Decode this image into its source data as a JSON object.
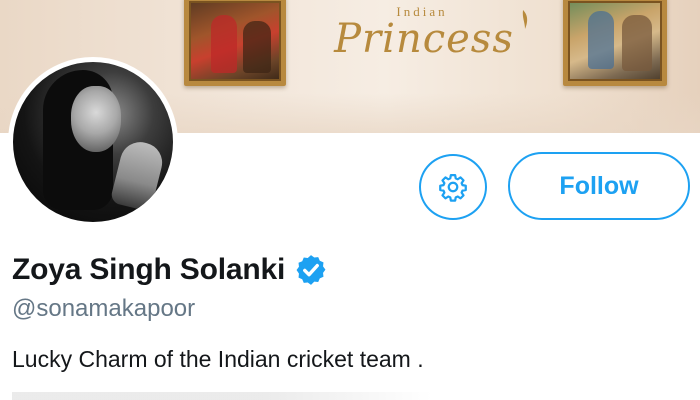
{
  "banner": {
    "logo_small": "Indian",
    "logo_big": "Princess"
  },
  "profile": {
    "display_name": "Zoya Singh Solanki",
    "handle": "@sonamakapoor",
    "bio": "Lucky Charm of the Indian cricket team .",
    "verified": true
  },
  "actions": {
    "follow_label": "Follow",
    "settings_icon": "gear-icon"
  },
  "colors": {
    "accent": "#1da1f2",
    "handle_gray": "#657786",
    "text": "#14171a",
    "logo_gold": "#b78a3d"
  }
}
